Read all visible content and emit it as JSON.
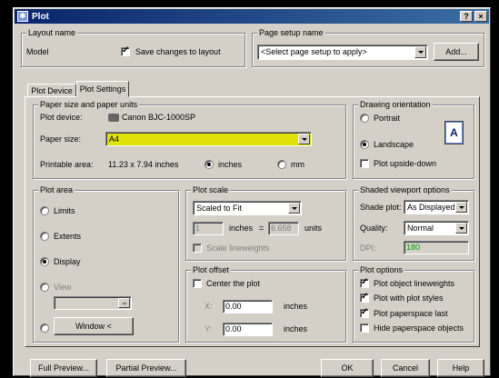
{
  "window": {
    "title": "Plot",
    "help_label": "?",
    "close_label": "×"
  },
  "layout_name": {
    "group_label": "Layout name",
    "name": "Model",
    "save_changes_label": "Save changes to layout",
    "save_changes_checked": true
  },
  "page_setup": {
    "group_label": "Page setup name",
    "selected": "<Select page setup to apply>",
    "add_label": "Add..."
  },
  "tabs": [
    {
      "label": "Plot Device",
      "active": false
    },
    {
      "label": "Plot Settings",
      "active": true
    }
  ],
  "paper": {
    "group_label": "Paper size and paper units",
    "device_label": "Plot device:",
    "device_value": "Canon BJC-1000SP",
    "size_label": "Paper size:",
    "size_value": "A4",
    "highlight_color": "#e1e10a",
    "printable_label": "Printable area:",
    "printable_value": "11.23 x 7.94 inches",
    "units": [
      {
        "label": "inches",
        "selected": true
      },
      {
        "label": "mm",
        "selected": false
      }
    ]
  },
  "orientation": {
    "group_label": "Drawing orientation",
    "options": [
      {
        "label": "Portrait",
        "selected": false
      },
      {
        "label": "Landscape",
        "selected": true
      }
    ],
    "icon_glyph": "A",
    "upside_down_label": "Plot upside-down",
    "upside_down_checked": false
  },
  "plot_area": {
    "group_label": "Plot area",
    "options": [
      {
        "label": "Limits",
        "selected": false
      },
      {
        "label": "Extents",
        "selected": false
      },
      {
        "label": "Display",
        "selected": true
      },
      {
        "label": "View",
        "selected": false
      }
    ],
    "view_select": "",
    "window_button_label": "Window <"
  },
  "plot_scale": {
    "group_label": "Plot scale",
    "selected": "Scaled to Fit",
    "value_inches": "1",
    "inches_label": "inches",
    "equals": "=",
    "value_units": "6.658",
    "units_label": "units",
    "scale_lineweights_label": "Scale lineweights",
    "scale_lineweights_checked": false
  },
  "shaded": {
    "group_label": "Shaded viewport options",
    "shade_plot_label": "Shade plot:",
    "shade_plot_value": "As Displayed",
    "quality_label": "Quality:",
    "quality_value": "Normal",
    "dpi_label": "DPI:",
    "dpi_value": "180",
    "dpi_color": "#00a000"
  },
  "plot_offset": {
    "group_label": "Plot offset",
    "center_label": "Center the plot",
    "center_checked": false,
    "x_label": "X:",
    "x_value": "0.00",
    "y_label": "Y:",
    "y_value": "0.00",
    "unit_label": "inches"
  },
  "plot_options": {
    "group_label": "Plot options",
    "items": [
      {
        "label": "Plot object lineweights",
        "checked": true
      },
      {
        "label": "Plot with plot styles",
        "checked": true
      },
      {
        "label": "Plot paperspace last",
        "checked": true
      },
      {
        "label": "Hide paperspace objects",
        "checked": false
      }
    ]
  },
  "footer": {
    "full_preview_label": "Full Preview...",
    "partial_preview_label": "Partial Preview...",
    "ok_label": "OK",
    "cancel_label": "Cancel",
    "help_label": "Help"
  }
}
